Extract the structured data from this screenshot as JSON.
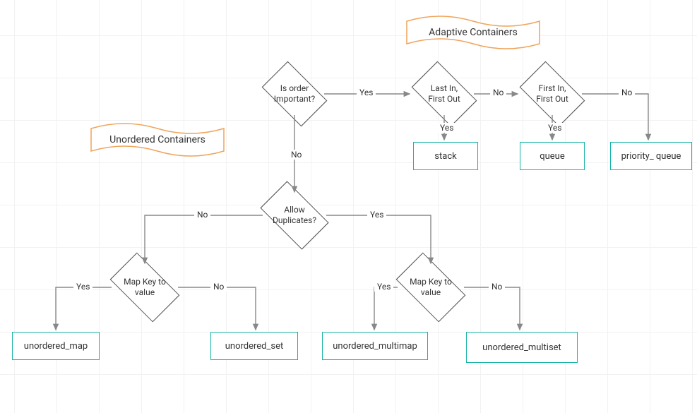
{
  "titles": {
    "adaptive": "Adaptive Containers",
    "unordered": "Unordered Containers"
  },
  "decisions": {
    "is_order": "Is order Important?",
    "lifo": "Last In, First Out",
    "fifo": "First In, First Out",
    "allow_dup": "Allow Duplicates?",
    "map_left": "Map Key to value",
    "map_right": "Map Key to value"
  },
  "labels": {
    "yes": "Yes",
    "no": "No"
  },
  "results": {
    "stack": "stack",
    "queue": "queue",
    "priority_queue": "priority_ queue",
    "unordered_map": "unordered_map",
    "unordered_set": "unordered_set",
    "unordered_multimap": "unordered_multimap",
    "unordered_multiset": "unordered_multiset"
  },
  "chart_data": {
    "type": "flowchart",
    "nodes": [
      {
        "id": "title_adaptive",
        "kind": "title",
        "label": "Adaptive Containers"
      },
      {
        "id": "title_unordered",
        "kind": "title",
        "label": "Unordered Containers"
      },
      {
        "id": "d_order",
        "kind": "decision",
        "label": "Is order Important?"
      },
      {
        "id": "d_lifo",
        "kind": "decision",
        "label": "Last In, First Out"
      },
      {
        "id": "d_fifo",
        "kind": "decision",
        "label": "First In, First Out"
      },
      {
        "id": "d_dup",
        "kind": "decision",
        "label": "Allow Duplicates?"
      },
      {
        "id": "d_map_l",
        "kind": "decision",
        "label": "Map Key to value"
      },
      {
        "id": "d_map_r",
        "kind": "decision",
        "label": "Map Key to value"
      },
      {
        "id": "r_stack",
        "kind": "result",
        "label": "stack"
      },
      {
        "id": "r_queue",
        "kind": "result",
        "label": "queue"
      },
      {
        "id": "r_pq",
        "kind": "result",
        "label": "priority_ queue"
      },
      {
        "id": "r_umap",
        "kind": "result",
        "label": "unordered_map"
      },
      {
        "id": "r_uset",
        "kind": "result",
        "label": "unordered_set"
      },
      {
        "id": "r_ummap",
        "kind": "result",
        "label": "unordered_multimap"
      },
      {
        "id": "r_umset",
        "kind": "result",
        "label": "unordered_multiset"
      }
    ],
    "edges": [
      {
        "from": "d_order",
        "to": "d_lifo",
        "label": "Yes"
      },
      {
        "from": "d_order",
        "to": "d_dup",
        "label": "No"
      },
      {
        "from": "d_lifo",
        "to": "r_stack",
        "label": "Yes"
      },
      {
        "from": "d_lifo",
        "to": "d_fifo",
        "label": "No"
      },
      {
        "from": "d_fifo",
        "to": "r_queue",
        "label": "Yes"
      },
      {
        "from": "d_fifo",
        "to": "r_pq",
        "label": "No"
      },
      {
        "from": "d_dup",
        "to": "d_map_l",
        "label": "No"
      },
      {
        "from": "d_dup",
        "to": "d_map_r",
        "label": "Yes"
      },
      {
        "from": "d_map_l",
        "to": "r_umap",
        "label": "Yes"
      },
      {
        "from": "d_map_l",
        "to": "r_uset",
        "label": "No"
      },
      {
        "from": "d_map_r",
        "to": "r_ummap",
        "label": "Yes"
      },
      {
        "from": "d_map_r",
        "to": "r_umset",
        "label": "No"
      }
    ]
  }
}
